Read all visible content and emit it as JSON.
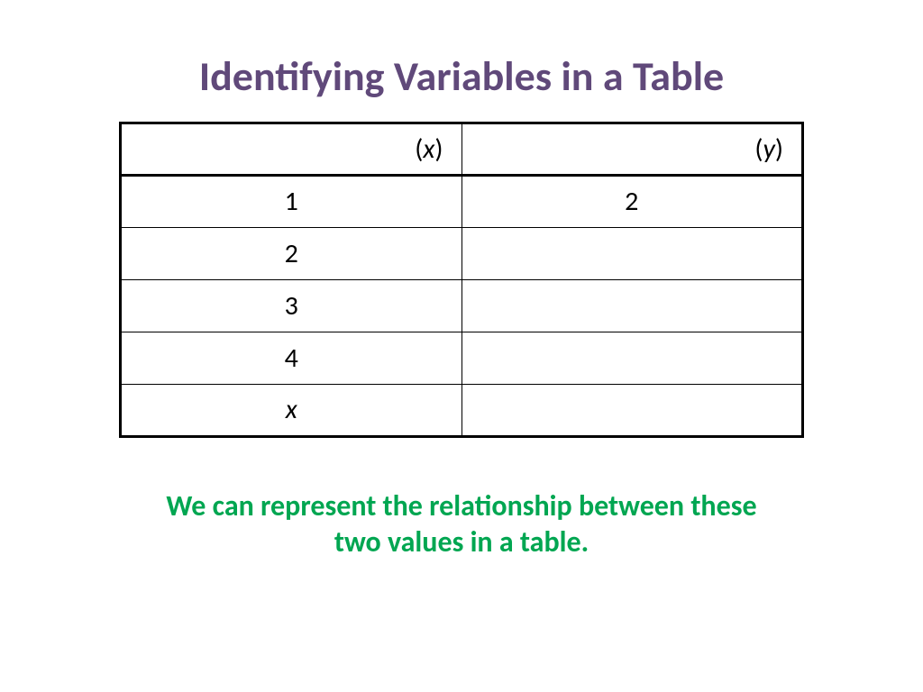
{
  "title": "Identifying Variables in a Table",
  "headers": {
    "col1_var": "x",
    "col2_var": "y"
  },
  "rows": [
    {
      "x": "1",
      "y": "2",
      "x_italic": false
    },
    {
      "x": "2",
      "y": "",
      "x_italic": false
    },
    {
      "x": "3",
      "y": "",
      "x_italic": false
    },
    {
      "x": "4",
      "y": "",
      "x_italic": false
    },
    {
      "x": "x",
      "y": "",
      "x_italic": true
    }
  ],
  "caption_line1": "We can represent the relationship between these",
  "caption_line2": "two values in a table.",
  "chart_data": {
    "type": "table",
    "title": "Identifying Variables in a Table",
    "columns": [
      "(x)",
      "(y)"
    ],
    "rows": [
      [
        "1",
        "2"
      ],
      [
        "2",
        ""
      ],
      [
        "3",
        ""
      ],
      [
        "4",
        ""
      ],
      [
        "x",
        ""
      ]
    ]
  }
}
